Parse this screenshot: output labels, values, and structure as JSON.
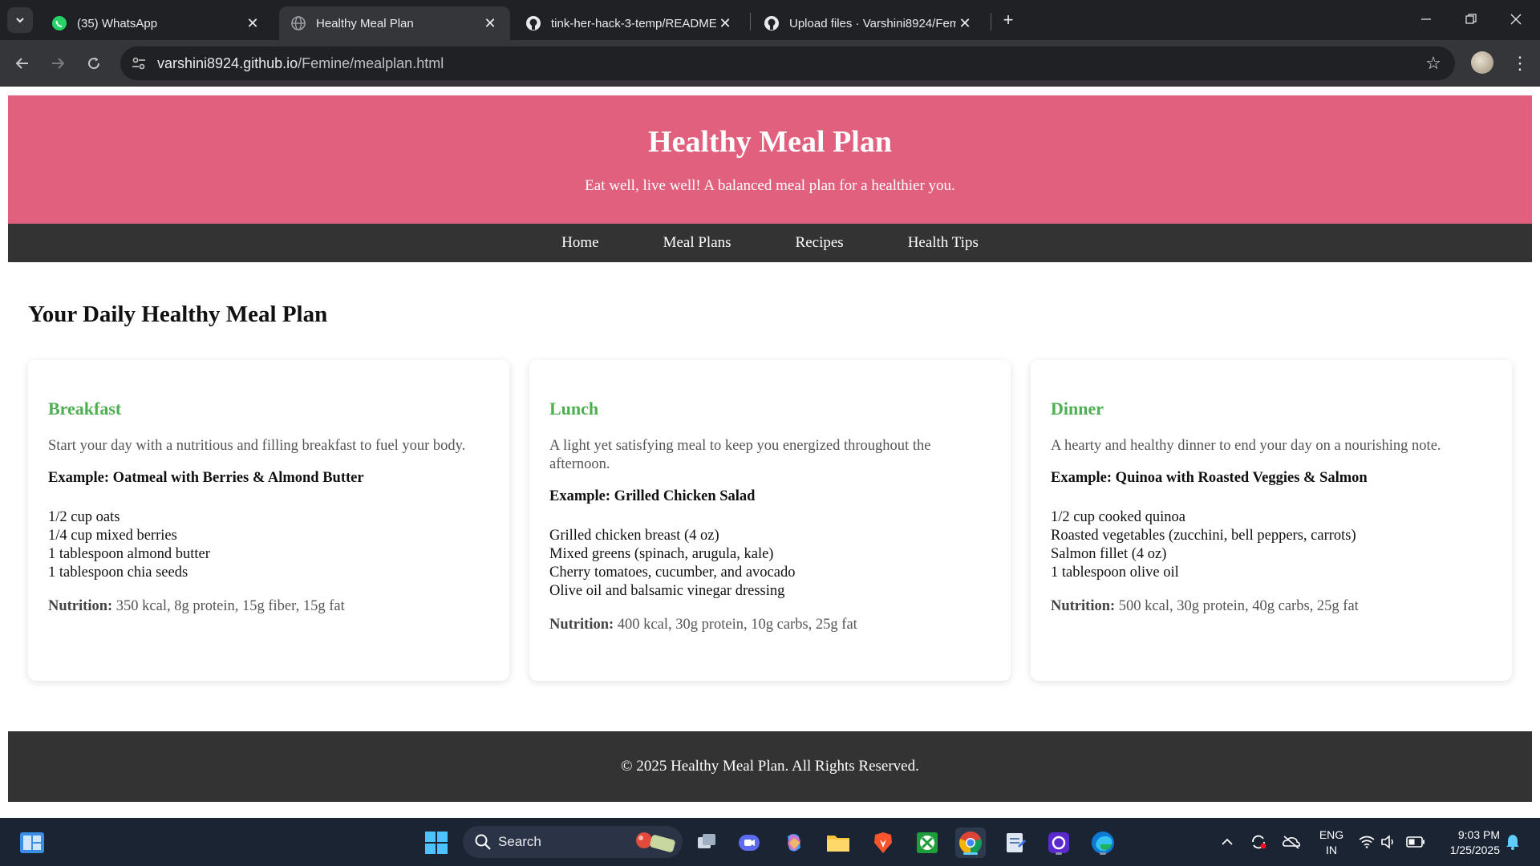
{
  "browser": {
    "tabs": [
      {
        "title": "(35) WhatsApp",
        "icon": "whatsapp-icon",
        "active": false
      },
      {
        "title": "Healthy Meal Plan",
        "icon": "globe-icon",
        "active": true
      },
      {
        "title": "tink-her-hack-3-temp/README",
        "icon": "github-icon",
        "active": false
      },
      {
        "title": "Upload files · Varshini8924/Fem",
        "icon": "github-icon",
        "active": false
      }
    ],
    "url_host": "varshini8924.github.io",
    "url_path": "/Femine/mealplan.html"
  },
  "page": {
    "header": {
      "title": "Healthy Meal Plan",
      "tagline": "Eat well, live well! A balanced meal plan for a healthier you."
    },
    "nav": [
      "Home",
      "Meal Plans",
      "Recipes",
      "Health Tips"
    ],
    "section_title": "Your Daily Healthy Meal Plan",
    "meals": [
      {
        "name": "Breakfast",
        "description": "Start your day with a nutritious and filling breakfast to fuel your body.",
        "example": "Example: Oatmeal with Berries & Almond Butter",
        "ingredients": [
          "1/2 cup oats",
          "1/4 cup mixed berries",
          "1 tablespoon almond butter",
          "1 tablespoon chia seeds"
        ],
        "nutrition_label": "Nutrition:",
        "nutrition": "350 kcal, 8g protein, 15g fiber, 15g fat"
      },
      {
        "name": "Lunch",
        "description": "A light yet satisfying meal to keep you energized throughout the afternoon.",
        "example": "Example: Grilled Chicken Salad",
        "ingredients": [
          "Grilled chicken breast (4 oz)",
          "Mixed greens (spinach, arugula, kale)",
          "Cherry tomatoes, cucumber, and avocado",
          "Olive oil and balsamic vinegar dressing"
        ],
        "nutrition_label": "Nutrition:",
        "nutrition": "400 kcal, 30g protein, 10g carbs, 25g fat"
      },
      {
        "name": "Dinner",
        "description": "A hearty and healthy dinner to end your day on a nourishing note.",
        "example": "Example: Quinoa with Roasted Veggies & Salmon",
        "ingredients": [
          "1/2 cup cooked quinoa",
          "Roasted vegetables (zucchini, bell peppers, carrots)",
          "Salmon fillet (4 oz)",
          "1 tablespoon olive oil"
        ],
        "nutrition_label": "Nutrition:",
        "nutrition": "500 kcal, 30g protein, 40g carbs, 25g fat"
      }
    ],
    "footer": "© 2025 Healthy Meal Plan. All Rights Reserved."
  },
  "taskbar": {
    "search_label": "Search",
    "lang_line1": "ENG",
    "lang_line2": "IN",
    "time": "9:03 PM",
    "date": "1/25/2025"
  },
  "colors": {
    "header": "#e0607e",
    "nav": "#333333",
    "meal_title": "#4caf50"
  }
}
